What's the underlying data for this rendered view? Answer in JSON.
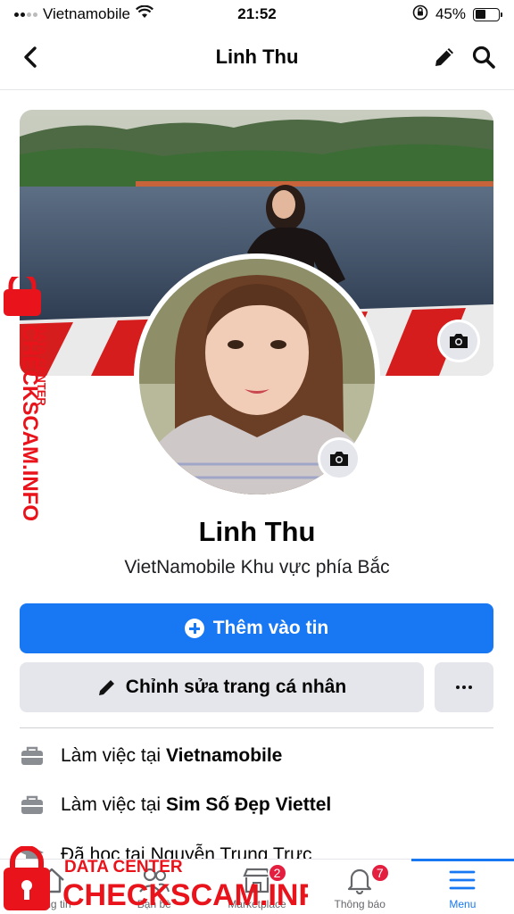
{
  "status_bar": {
    "carrier": "Vietnamobile",
    "time": "21:52",
    "battery_percent": "45%",
    "battery_level": 0.45
  },
  "nav": {
    "title": "Linh Thu"
  },
  "profile": {
    "name": "Linh Thu",
    "bio": "VietNamobile Khu vực phía Bắc"
  },
  "actions": {
    "add_story_label": "Thêm vào tin",
    "edit_profile_label": "Chỉnh sửa trang cá nhân"
  },
  "details": [
    {
      "prefix": "Làm việc tại",
      "value": "Vietnamobile"
    },
    {
      "prefix": "Làm việc tại",
      "value": "Sim Số Đẹp Viettel"
    },
    {
      "prefix": "Đã học tại",
      "value": "Nguyễn Trung Trực"
    }
  ],
  "tabs": [
    {
      "label": "Bảng tin",
      "icon": "home-icon",
      "badge": ""
    },
    {
      "label": "Bạn bè",
      "icon": "friends-icon",
      "badge": ""
    },
    {
      "label": "Marketplace",
      "icon": "marketplace-icon",
      "badge": "2"
    },
    {
      "label": "Thông báo",
      "icon": "bell-icon",
      "badge": "7"
    },
    {
      "label": "Menu",
      "icon": "menu-icon",
      "badge": "",
      "active": true
    }
  ],
  "watermark": {
    "top_text": "DATA CENTER",
    "main_text": "CHECKSCAM.INFO"
  },
  "colors": {
    "primary": "#1877f2",
    "badge": "#e41e3f",
    "button_gray": "#e4e6eb",
    "watermark_red": "#e8131b"
  }
}
